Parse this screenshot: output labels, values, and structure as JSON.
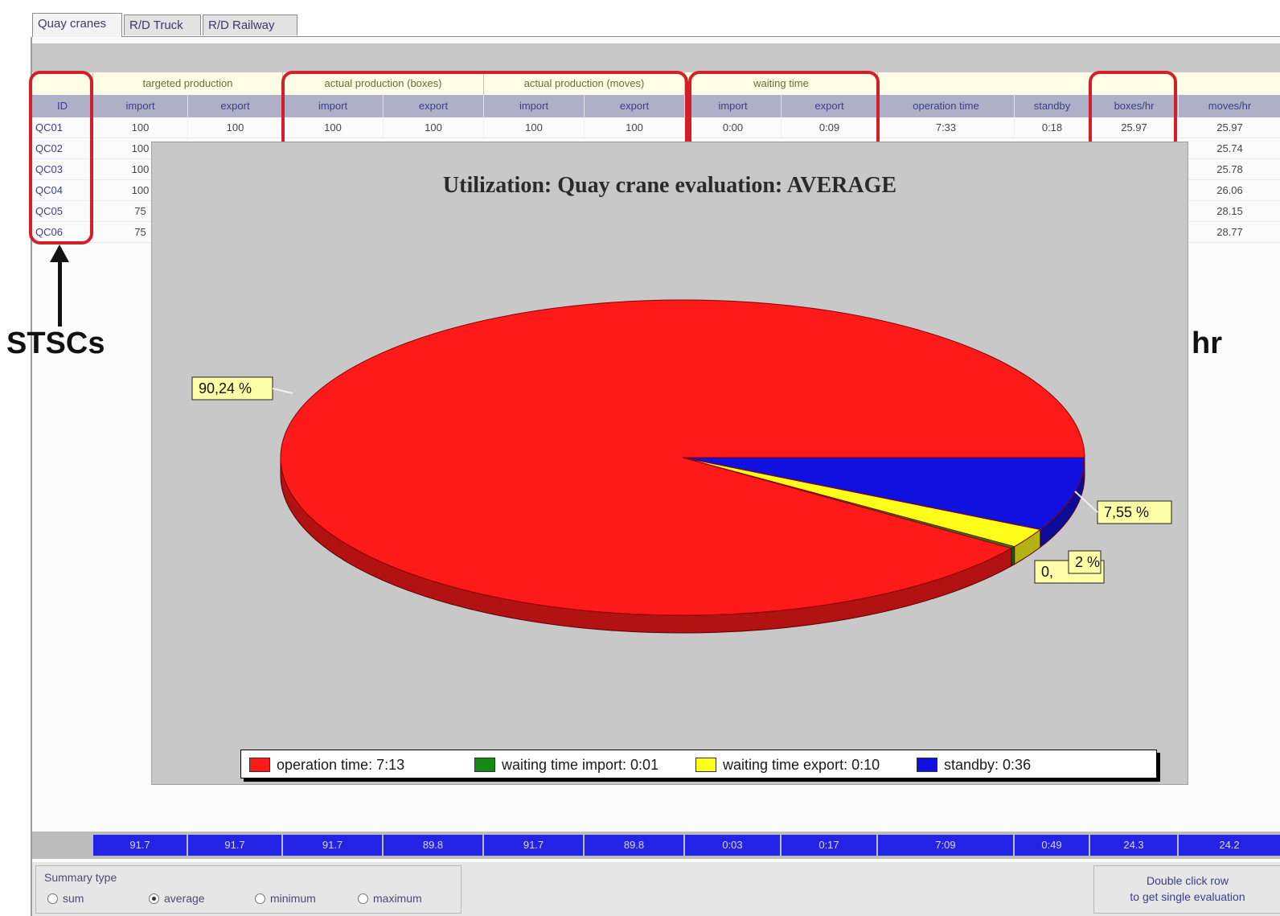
{
  "tabs": [
    "Quay cranes",
    "R/D Truck",
    "R/D Railway"
  ],
  "grid": {
    "groups": [
      {
        "label": ""
      },
      {
        "label": "targeted production"
      },
      {
        "label": "actual production (boxes)"
      },
      {
        "label": "actual production (moves)"
      },
      {
        "label": "waiting time"
      },
      {
        "label": ""
      }
    ],
    "columns": [
      "ID",
      "import",
      "export",
      "import",
      "export",
      "import",
      "export",
      "import",
      "export",
      "operation time",
      "standby",
      "boxes/hr",
      "moves/hr"
    ],
    "rows": [
      {
        "id": "QC01",
        "t_import": "100",
        "t_export": "100",
        "ab_import": "100",
        "ab_export": "100",
        "am_import": "100",
        "am_export": "100",
        "w_import": "0:00",
        "w_export": "0:09",
        "operation": "7:33",
        "standby": "0:18",
        "boxes_hr": "25.97",
        "moves_hr": "25.97"
      },
      {
        "id": "QC02",
        "t_import": "100",
        "moves_hr": "25.74"
      },
      {
        "id": "QC03",
        "t_import": "100",
        "moves_hr": "25.78"
      },
      {
        "id": "QC04",
        "t_import": "100",
        "moves_hr": "26.06"
      },
      {
        "id": "QC05",
        "t_import": "75",
        "moves_hr": "28.15"
      },
      {
        "id": "QC06",
        "t_import": "75",
        "moves_hr": "28.77"
      }
    ]
  },
  "annotations": {
    "left_label": "STSCs",
    "right_label_fragment": "hr"
  },
  "chart": {
    "title": "Utilization: Quay crane evaluation: AVERAGE",
    "labels": {
      "operation": "90,24 %",
      "standby": "7,55 %",
      "waiting_export": "2 %",
      "waiting_import_partial": "0,"
    },
    "legend": [
      {
        "label": "operation time: 7:13",
        "color": "#ff1a1a"
      },
      {
        "label": "waiting time import: 0:01",
        "color": "#138a13"
      },
      {
        "label": "waiting time export: 0:10",
        "color": "#ffff1a"
      },
      {
        "label": "standby: 0:36",
        "color": "#1010e0"
      }
    ]
  },
  "chart_data": {
    "type": "pie",
    "title": "Utilization: Quay crane evaluation: AVERAGE",
    "categories": [
      "operation time",
      "waiting time import",
      "waiting time export",
      "standby"
    ],
    "values": [
      90.24,
      0.21,
      2.0,
      7.55
    ],
    "colors": [
      "#ff1a1a",
      "#138a13",
      "#ffff1a",
      "#1010e0"
    ],
    "legend_position": "bottom"
  },
  "summary_values": [
    "91.7",
    "91.7",
    "91.7",
    "89.8",
    "91.7",
    "89.8",
    "0:03",
    "0:17",
    "7:09",
    "0:49",
    "24.3",
    "24.2"
  ],
  "footer": {
    "summary_type_label": "Summary type",
    "options": [
      "sum",
      "average",
      "minimum",
      "maximum"
    ],
    "selected": "average",
    "hint_line1": "Double click row",
    "hint_line2": "to get single evaluation"
  }
}
